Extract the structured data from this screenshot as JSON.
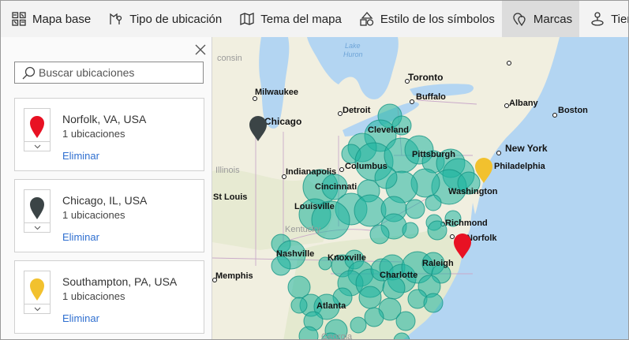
{
  "toolbar": {
    "items": [
      {
        "label": "Mapa base",
        "icon": "basemap-icon"
      },
      {
        "label": "Tipo de ubicación",
        "icon": "location-type-icon"
      },
      {
        "label": "Tema del mapa",
        "icon": "map-theme-icon"
      },
      {
        "label": "Estilo de los símbolos",
        "icon": "symbol-style-icon"
      },
      {
        "label": "Marcas",
        "icon": "pins-icon",
        "active": true
      },
      {
        "label": "Tiempo de conducción",
        "icon": "drive-time-icon"
      }
    ]
  },
  "panel": {
    "search_placeholder": "Buscar ubicaciones",
    "pins": [
      {
        "name": "Norfolk, VA, USA",
        "count": "1 ubicaciones",
        "remove": "Eliminar",
        "color": "#e81123"
      },
      {
        "name": "Chicago, IL, USA",
        "count": "1 ubicaciones",
        "remove": "Eliminar",
        "color": "#3b4446"
      },
      {
        "name": "Southampton, PA, USA",
        "count": "1 ubicaciones",
        "remove": "Eliminar",
        "color": "#f2c12e"
      }
    ]
  },
  "map": {
    "cities": {
      "toronto": "Toronto",
      "buffalo": "Buffalo",
      "albany": "Albany",
      "boston": "Boston",
      "milwaukee": "Milwaukee",
      "chicago": "Chicago",
      "detroit": "Detroit",
      "cleveland": "Cleveland",
      "pittsburgh": "Pittsburgh",
      "new_york": "New York",
      "philadelphia": "Philadelphia",
      "indianapolis": "Indianapolis",
      "columbus": "Columbus",
      "cincinnati": "Cincinnati",
      "washington": "Washington",
      "louisville": "Louisville",
      "richmond": "Richmond",
      "norfolk": "Norfolk",
      "nashville": "Nashville",
      "knoxville": "Knoxville",
      "charlotte": "Charlotte",
      "raleigh": "Raleigh",
      "memphis": "Memphis",
      "atlanta": "Atlanta",
      "st_louis": "St Louis",
      "illinois": "Illinois",
      "kentucky": "Kentucky",
      "georgia": "Georgia",
      "wisconsin": "consin"
    },
    "water": {
      "lake_huron": [
        "Lake",
        "Huron"
      ]
    },
    "colors": {
      "land": "#f1efe0",
      "water": "#b3d5f2",
      "bubble": "#1fb5a1",
      "bubble_stroke": "#159585"
    }
  }
}
